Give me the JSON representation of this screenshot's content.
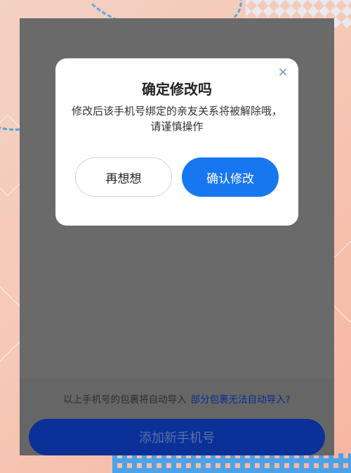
{
  "dialog": {
    "title": "确定修改吗",
    "message": "修改后该手机号绑定的亲友关系将被解除哦，请谨慎操作",
    "close_icon": "×",
    "cancel_label": "再想想",
    "confirm_label": "确认修改"
  },
  "footer": {
    "hint_text": "以上手机号的包裹将自动导入",
    "hint_link": "部分包裹无法自动导入?",
    "add_button_label": "添加新手机号"
  },
  "colors": {
    "primary": "#1677f0",
    "overlay": "#6a6a6a",
    "dark_button": "#0b3198",
    "link": "#0a2d8c"
  }
}
